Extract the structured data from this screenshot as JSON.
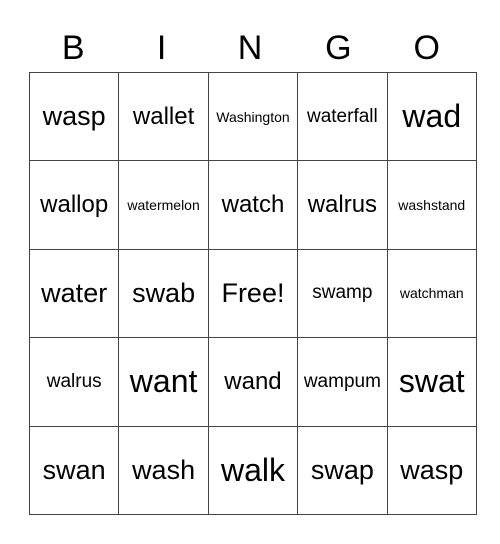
{
  "header": [
    "B",
    "I",
    "N",
    "G",
    "O"
  ],
  "rows": [
    [
      "wasp",
      "wallet",
      "Washington",
      "waterfall",
      "wad"
    ],
    [
      "wallop",
      "watermelon",
      "watch",
      "walrus",
      "washstand"
    ],
    [
      "water",
      "swab",
      "Free!",
      "swamp",
      "watchman"
    ],
    [
      "walrus",
      "want",
      "wand",
      "wampum",
      "swat"
    ],
    [
      "swan",
      "wash",
      "walk",
      "swap",
      "wasp"
    ]
  ]
}
